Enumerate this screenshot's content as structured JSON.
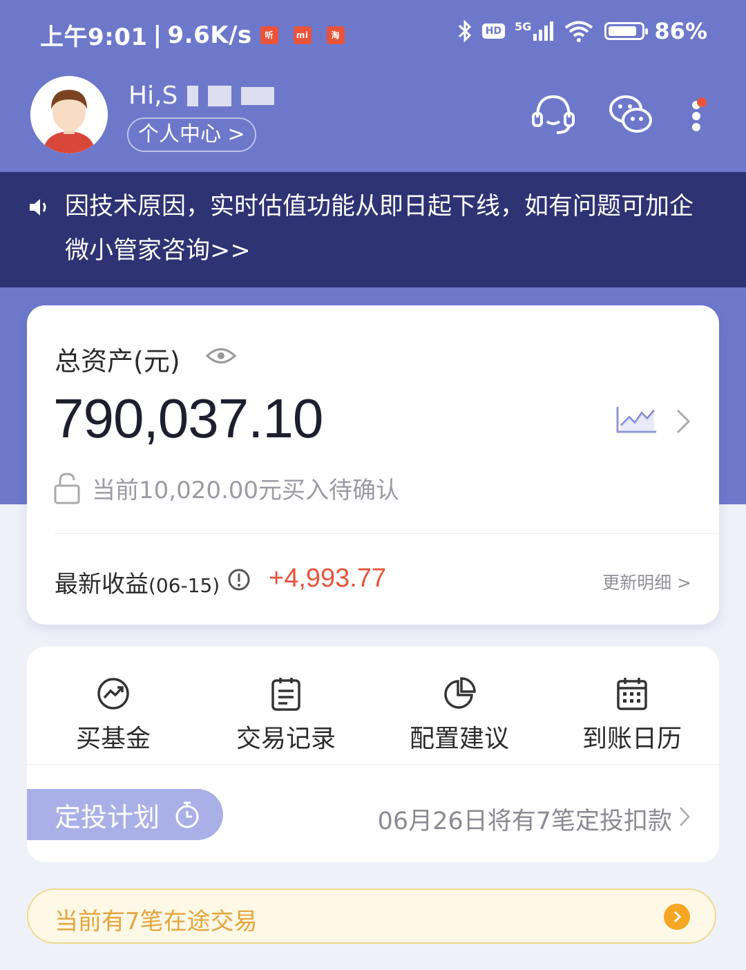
{
  "status_bar": {
    "time": "上午9:01",
    "separator": "|",
    "net_speed": "9.6K/s",
    "app_badges": [
      "听",
      "mi",
      "淘"
    ],
    "hd": "HD",
    "network": "5G",
    "battery_percent": "86%",
    "battery_level": 0.86
  },
  "profile": {
    "greeting": "Hi,",
    "greeting_char": "S",
    "personal_center": "个人中心 >"
  },
  "notice": {
    "text": "因技术原因，实时估值功能从即日起下线，如有问题可加企微小管家咨询>>"
  },
  "assets": {
    "label": "总资产(元)",
    "total_value": "790,037.10",
    "pending_text": "当前10,020.00元买入待确认",
    "income_label": "最新收益",
    "income_date": "(06-15)",
    "income_value": "+4,993.77",
    "update_link": "更新明细 >"
  },
  "menu": {
    "items": [
      {
        "label": "买基金",
        "icon": "buy-fund-icon"
      },
      {
        "label": "交易记录",
        "icon": "transaction-record-icon"
      },
      {
        "label": "配置建议",
        "icon": "pie-chart-icon"
      },
      {
        "label": "到账日历",
        "icon": "calendar-icon"
      }
    ],
    "plan_label": "定投计划",
    "plan_info": "06月26日将有7笔定投扣款"
  },
  "transit": {
    "text": "当前有7笔在途交易"
  },
  "colors": {
    "header_bg": "#6d78cb",
    "notice_bg": "#2d3373",
    "income_red": "#e8533a",
    "transit_orange": "#f5a623"
  }
}
